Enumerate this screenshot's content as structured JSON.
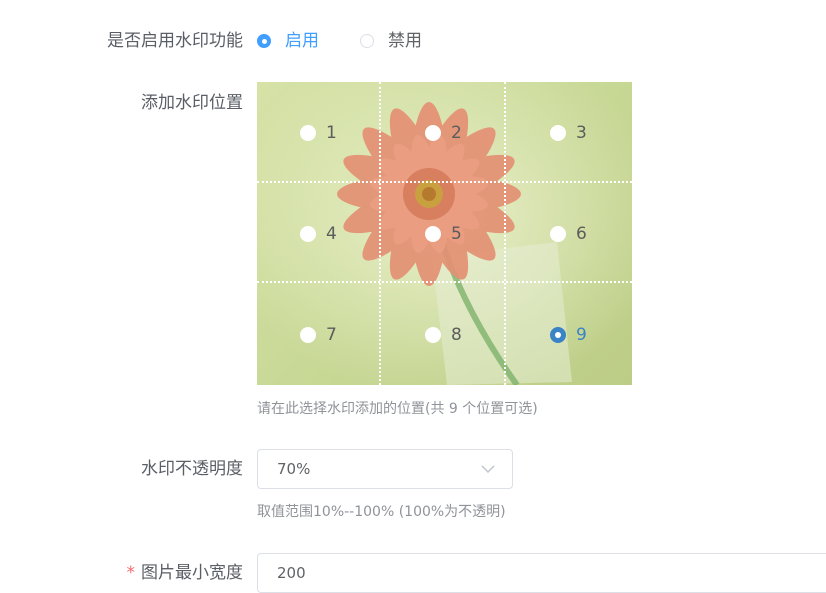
{
  "watermark_enable": {
    "label": "是否启用水印功能",
    "options": [
      {
        "label": "启用",
        "selected": true
      },
      {
        "label": "禁用",
        "selected": false
      }
    ]
  },
  "watermark_position": {
    "label": "添加水印位置",
    "positions": [
      {
        "label": "1",
        "selected": false
      },
      {
        "label": "2",
        "selected": false
      },
      {
        "label": "3",
        "selected": false
      },
      {
        "label": "4",
        "selected": false
      },
      {
        "label": "5",
        "selected": false
      },
      {
        "label": "6",
        "selected": false
      },
      {
        "label": "7",
        "selected": false
      },
      {
        "label": "8",
        "selected": false
      },
      {
        "label": "9",
        "selected": true
      }
    ],
    "hint": "请在此选择水印添加的位置(共 9 个位置可选)"
  },
  "opacity": {
    "label": "水印不透明度",
    "value": "70%",
    "hint": "取值范围10%--100% (100%为不透明)"
  },
  "min_width": {
    "required_mark": "*",
    "label": "图片最小宽度",
    "value": "200"
  },
  "colors": {
    "accent": "#409eff",
    "selected_position": "#3a83c7",
    "required": "#f56c6c"
  }
}
